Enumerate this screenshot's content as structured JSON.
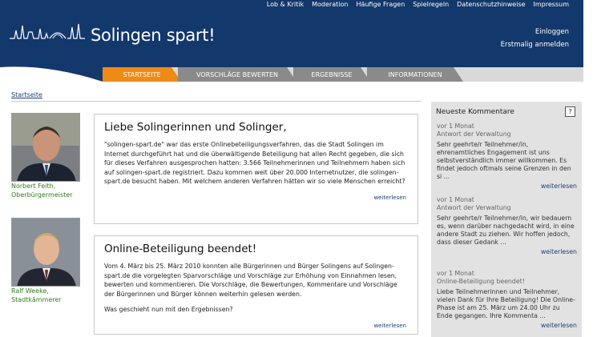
{
  "header": {
    "brand": "Solingen spart!",
    "top_links": [
      "Lob & Kritik",
      "Moderation",
      "Häufige Fragen",
      "Spielregeln",
      "Datenschutzhinweise",
      "Impressum"
    ],
    "login": "Einloggen",
    "register": "Erstmalig anmelden"
  },
  "tabs": [
    {
      "label": "Startseite"
    },
    {
      "label": "Vorschläge bewerten"
    },
    {
      "label": "Ergebnisse"
    },
    {
      "label": "Informationen"
    }
  ],
  "colors": {
    "header_bg": "#13386b",
    "active_tab": "#ef8a14",
    "tab": "#8a8a8a",
    "caption": "#2e7d1c",
    "link": "#1a3f73"
  },
  "breadcrumb": "Startseite",
  "people": [
    {
      "name": "Norbert Feith,",
      "role": "Oberbürgermeister"
    },
    {
      "name": "Ralf Weeke,",
      "role": "Stadtkämmerer"
    }
  ],
  "articles": [
    {
      "title": "Liebe Solingerinnen und Solinger,",
      "text": "\"solingen-spart.de\" war das erste Onlinebeteiligungsverfahren, das die Stadt Solingen im Internet durchgeführt hat und die überwältigende Beteiligung hat allen Recht gegeben, die sich für dieses Verfahren ausgesprochen hatten: 3.566 Teilnehmerinnen und Teilnehmern haben sich auf solingen-spart.de registriert. Dazu kommen weit über 20.000 Internetnutzer, die solingen-spart.de besucht haben. Mit welchem anderen Verfahren hätten wir so viele Menschen erreicht?",
      "more": "weiterlesen"
    },
    {
      "title": "Online-Beteiligung beendet!",
      "text": "Vom 4. März bis 25. März 2010 konnten alle Bürgerinnen und Bürger Solingens auf Solingen-spart.de die vorgelegten Sparvorschläge und Vorschläge zur Erhöhung von Einnahmen lesen, bewerten und kommentieren. Die Vorschläge, die Bewertungen, Kommentare und Vorschläge der Bürgerinnen und Bürger können weiterhin gelesen werden.",
      "text2": "Was geschieht nun mit den Ergebnissen?",
      "more": "weiterlesen"
    }
  ],
  "sidebar": {
    "title": "Neueste Kommentare",
    "help": "?",
    "comments": [
      {
        "time": "vor 1 Monat",
        "topic": "Antwort der Verwaltung",
        "text": "Sehr geehrte/r Teilnehmer/in, ehrenamtliches Engagement ist uns selbstverständlich immer willkommen. Es findet jedoch oftmals seine Grenzen in den si ...",
        "more": "weiterlesen"
      },
      {
        "time": "vor 1 Monat",
        "topic": "Antwort der Verwaltung",
        "text": "Sehr geehrte/r Teilnehmer/in, wir bedauern es, wenn darüber nachgedacht wird, in eine andere Stadt zu ziehen. Wir hoffen jedoch, dass dieser Gedank ...",
        "more": "weiterlesen"
      },
      {
        "time": "vor 1 Monat",
        "topic": "Online-Beteiligung beendet!",
        "text": "Liebe Teilnehmerinnen und Teilnehmer, vielen Dank für Ihre Beteiligung! Die Online-Phase ist am 25. März um 24.00 Uhr zu Ende gegangen. Ihre Kommenta ...",
        "more": "weiterlesen"
      }
    ]
  }
}
